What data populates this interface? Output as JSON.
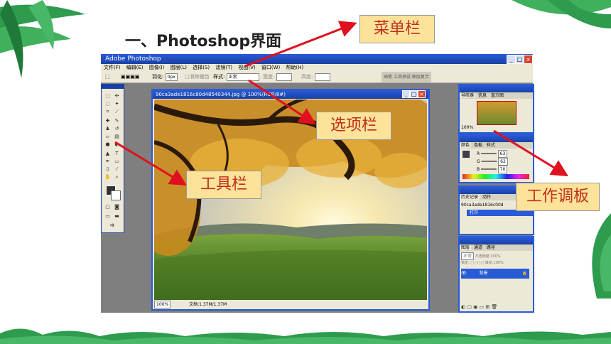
{
  "slide": {
    "title": "一、Photoshop界面"
  },
  "app": {
    "window_title": "Adobe Photoshop",
    "menu": [
      "文件(F)",
      "编辑(E)",
      "图像(I)",
      "图层(L)",
      "选择(S)",
      "滤镜(T)",
      "视图(V)",
      "窗口(W)",
      "帮助(H)"
    ],
    "options": {
      "feather_label": "羽化:",
      "feather_value": "0px",
      "antialias_label": "消除锯齿",
      "style_label": "样式:",
      "style_value": "正常",
      "width_label": "宽度:",
      "height_label": "高度:"
    },
    "palette_well": [
      "画笔",
      "工具预设",
      "图层复合"
    ],
    "document": {
      "title": "90ca3ade1816c80d48540344.jpg @ 100%(RGB/8#)",
      "zoom": "100%",
      "doc_size": "文档:1.37M/1.37M"
    },
    "panels": {
      "navigator": {
        "tabs": [
          "导航器",
          "信息",
          "直方图"
        ],
        "zoom": "100%"
      },
      "color": {
        "tabs": [
          "颜色",
          "色板",
          "样式"
        ],
        "channels": [
          "R",
          "G",
          "B"
        ],
        "values": [
          "63",
          "62",
          "70"
        ]
      },
      "history": {
        "tabs": [
          "历史记录",
          "动作"
        ],
        "snapshot": "90ca3ade1816c00d",
        "step": "打开"
      },
      "layers": {
        "tabs": [
          "图层",
          "通道",
          "路径"
        ],
        "blend": "正常",
        "opacity_label": "不透明度:",
        "opacity": "100%",
        "lock_label": "锁定:",
        "fill_label": "填充:",
        "fill": "100%",
        "layer_name": "背景"
      }
    }
  },
  "callouts": {
    "menubar": "菜单栏",
    "optionsbar": "选项栏",
    "toolbox": "工具栏",
    "panels": "工作调板"
  },
  "colors": {
    "callout_bg": "#fde29a",
    "callout_text": "#c0301b",
    "arrow": "#e0101e",
    "title_bar": "#2a5bd7"
  }
}
